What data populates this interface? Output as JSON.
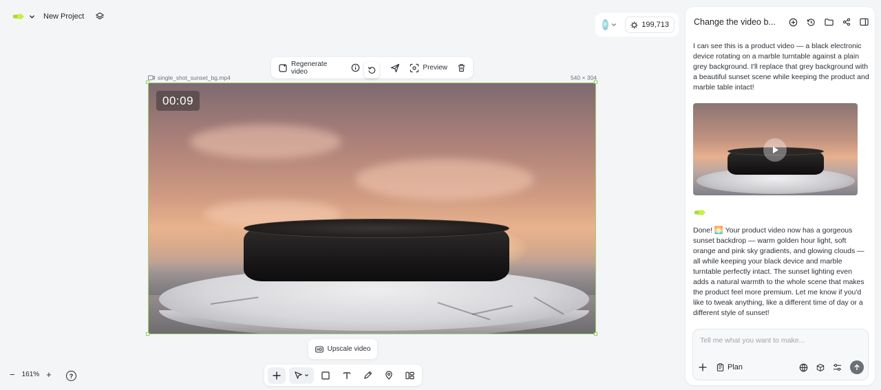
{
  "project": {
    "name": "New Project"
  },
  "credits": {
    "amount": "199,713"
  },
  "video_toolbar": {
    "regenerate_label": "Regenerate video",
    "preview_label": "Preview"
  },
  "video": {
    "filename": "single_shot_sunset_bg.mp4",
    "dimensions": "540 × 304",
    "timestamp": "00:09"
  },
  "upscale": {
    "label": "Upscale video"
  },
  "zoom": {
    "level": "161%",
    "minus": "−",
    "plus": "+",
    "help": "?"
  },
  "chat": {
    "title": "Change the video b...",
    "message_1": "I can see this is a product video — a black electronic device rotating on a marble turntable against a plain grey background. I'll replace that grey background with a beautiful sunset scene while keeping the product and marble table intact!",
    "message_2": "Done! 🌅 Your product video now has a gorgeous sunset backdrop — warm golden hour light, soft orange and pink sky gradients, and glowing clouds — all while keeping your black device and marble turntable perfectly intact. The sunset lighting even adds a natural warmth to the whole scene that makes the product feel more premium. Let me know if you'd like to tweak anything, like a different time of day or a different style of sunset!",
    "input_placeholder": "Tell me what you want to make...",
    "plan_label": "Plan"
  },
  "colors": {
    "accent_green": "#9fd36b",
    "logo_green": "#c6f046",
    "send_button": "#6b6f76"
  }
}
